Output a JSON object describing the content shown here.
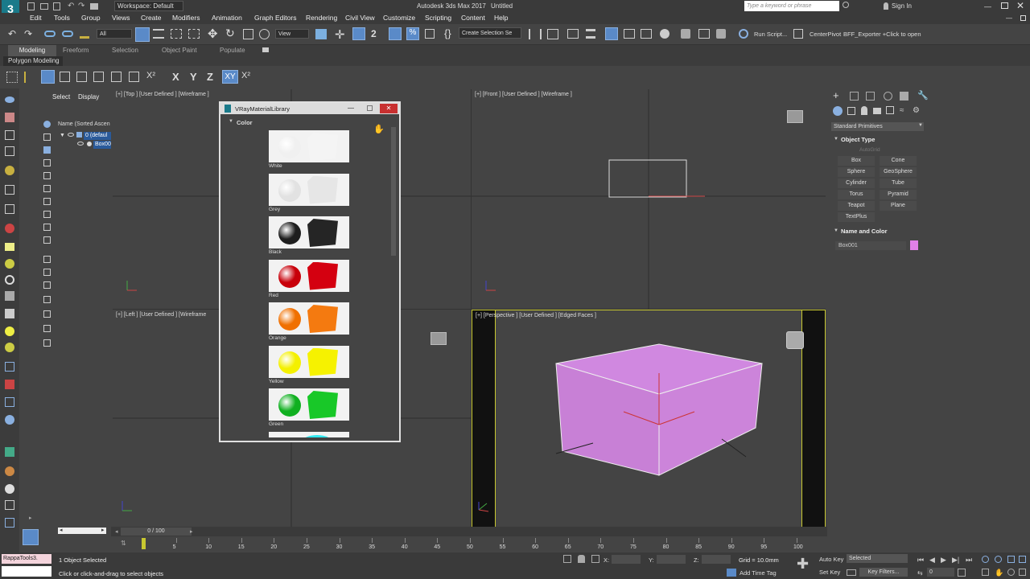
{
  "app": {
    "title": "Autodesk 3ds Max 2017",
    "doc": "Untitled",
    "workspace": "Workspace: Default",
    "search_placeholder": "Type a keyword or phrase",
    "sign_in": "Sign In",
    "logo_text": "3"
  },
  "menu": [
    "Edit",
    "Tools",
    "Group",
    "Views",
    "Create",
    "Modifiers",
    "Animation",
    "Graph Editors",
    "Rendering",
    "Civil View",
    "Customize",
    "Scripting",
    "Content",
    "Help"
  ],
  "toolbar": {
    "filter_value": "All",
    "view_value": "View",
    "selection_set": "Create Selection Se",
    "run_script": "Run Script...",
    "center_pivot": "CenterPivot",
    "bff_exporter": "BFF_Exporter +Click to open"
  },
  "ribbon": {
    "tabs": [
      "Modeling",
      "Freeform",
      "Selection",
      "Object Paint",
      "Populate"
    ],
    "panel_label": "Polygon Modeling"
  },
  "axis_buttons": [
    "X",
    "Y",
    "Z",
    "XY"
  ],
  "scene_explorer": {
    "tabs": [
      "Select",
      "Display"
    ],
    "header": "Name (Sorted Ascen",
    "items": [
      "0 (defaul",
      "Box00"
    ]
  },
  "viewports": {
    "top": "[+] [Top ] [User Defined ] [Wireframe ]",
    "front": "[+] [Front ] [User Defined ] [Wireframe ]",
    "left": "[+] [Left ] [User Defined ] [Wireframe",
    "perspective": "[+] [Perspective ] [User Defined ] [Edged Faces ]"
  },
  "material_library": {
    "title": "VRayMaterialLibrary",
    "section": "Color",
    "items": [
      {
        "label": "White",
        "sphere": "#f0f0f0",
        "cube": "#f4f4f4"
      },
      {
        "label": "Grey",
        "sphere": "#e2e2e2",
        "cube": "#e6e6e6"
      },
      {
        "label": "Black",
        "sphere": "#1e1e1e",
        "cube": "#252525"
      },
      {
        "label": "Red",
        "sphere": "#c8000a",
        "cube": "#d40010"
      },
      {
        "label": "Orange",
        "sphere": "#f07000",
        "cube": "#f47a10"
      },
      {
        "label": "Yellow",
        "sphere": "#f4f000",
        "cube": "#f6f200"
      },
      {
        "label": "Green",
        "sphere": "#10b020",
        "cube": "#18c828"
      }
    ]
  },
  "command_panel": {
    "dropdown": "Standard Primitives",
    "object_type_label": "Object Type",
    "autogrid": "AutoGrid",
    "buttons": [
      "Box",
      "Cone",
      "Sphere",
      "GeoSphere",
      "Cylinder",
      "Tube",
      "Torus",
      "Pyramid",
      "Teapot",
      "Plane",
      "TextPlus"
    ],
    "name_color_label": "Name and Color",
    "object_name": "Box001",
    "object_color": "#e080e8"
  },
  "timeline": {
    "frame": "0 / 100",
    "ticks": [
      "0",
      "5",
      "10",
      "15",
      "20",
      "25",
      "30",
      "35",
      "40",
      "45",
      "50",
      "55",
      "60",
      "65",
      "70",
      "75",
      "80",
      "85",
      "90",
      "95",
      "100"
    ]
  },
  "status": {
    "maxscript": "RappaTools3.",
    "selected": "1 Object Selected",
    "prompt": "Click or click-and-drag to select objects",
    "x_label": "X:",
    "y_label": "Y:",
    "z_label": "Z:",
    "grid": "Grid = 10.0mm",
    "add_time_tag": "Add Time Tag",
    "auto_key": "Auto Key",
    "set_key": "Set Key",
    "selected_dropdown": "Selected",
    "key_filters": "Key Filters...",
    "frame_value": "0"
  },
  "colors": {
    "box": "#cc80d8",
    "accent_blue": "#5a8ac8",
    "viewport_bg": "#444444",
    "active_border": "#c8c830"
  }
}
